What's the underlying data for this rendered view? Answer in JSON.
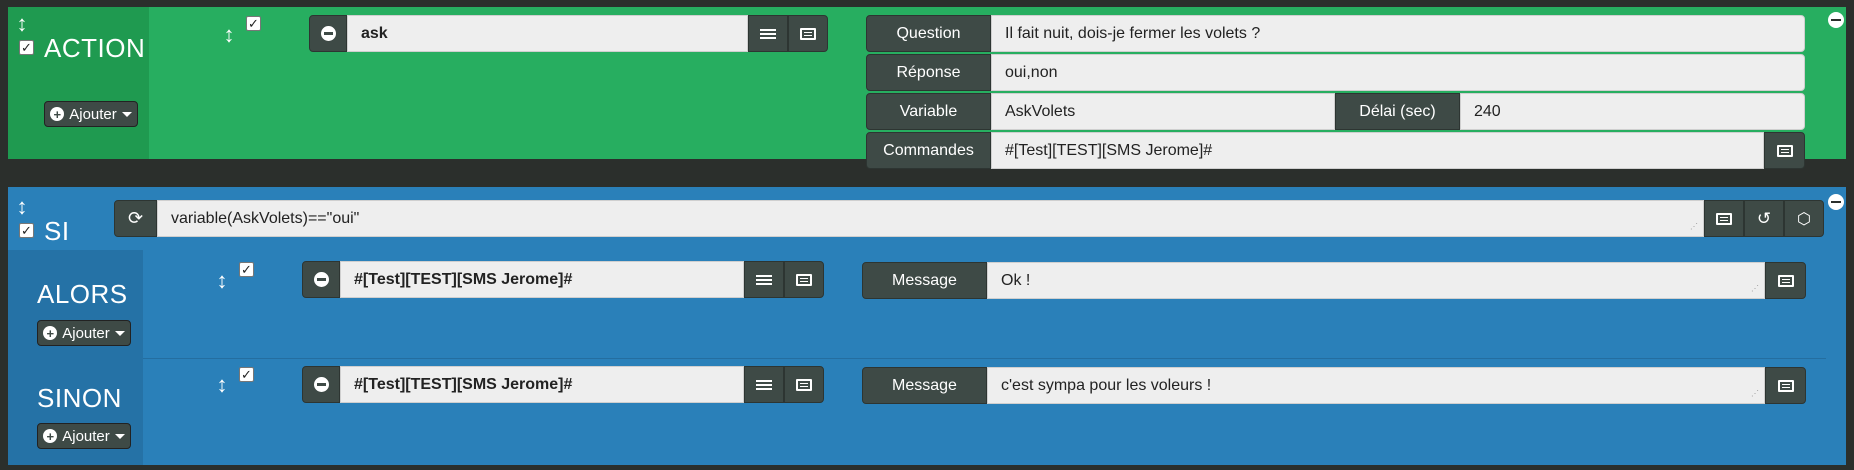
{
  "action_block": {
    "title": "ACTION",
    "ajouter_label": "Ajouter",
    "command_value": "ask",
    "question_label": "Question",
    "question_value": "Il fait nuit, dois-je fermer les volets ?",
    "reponse_label": "Réponse",
    "reponse_value": "oui,non",
    "variable_label": "Variable",
    "variable_value": "AskVolets",
    "delai_label": "Délai (sec)",
    "delai_value": "240",
    "commandes_label": "Commandes",
    "commandes_value": "#[Test][TEST][SMS Jerome]#"
  },
  "si_block": {
    "title": "SI",
    "condition_value": "variable(AskVolets)==\"oui\"",
    "alors": {
      "title": "ALORS",
      "ajouter_label": "Ajouter",
      "command_value": "#[Test][TEST][SMS Jerome]#",
      "message_label": "Message",
      "message_value": "Ok !"
    },
    "sinon": {
      "title": "SINON",
      "ajouter_label": "Ajouter",
      "command_value": "#[Test][TEST][SMS Jerome]#",
      "message_label": "Message",
      "message_value": "c'est sympa pour les voleurs !"
    }
  },
  "colors": {
    "action_green": "#27ae60",
    "action_dark_green": "#1f9a50",
    "si_blue": "#2a80b9",
    "si_dark_blue": "#2572a6",
    "control_dark": "#3e4a46"
  },
  "icons": [
    "move-icon",
    "checkbox-icon",
    "plus-circle-icon",
    "caret-down-icon",
    "minus-circle-icon",
    "sliders-icon",
    "list-icon",
    "refresh-icon",
    "history-icon",
    "cube-icon",
    "remove-icon"
  ]
}
